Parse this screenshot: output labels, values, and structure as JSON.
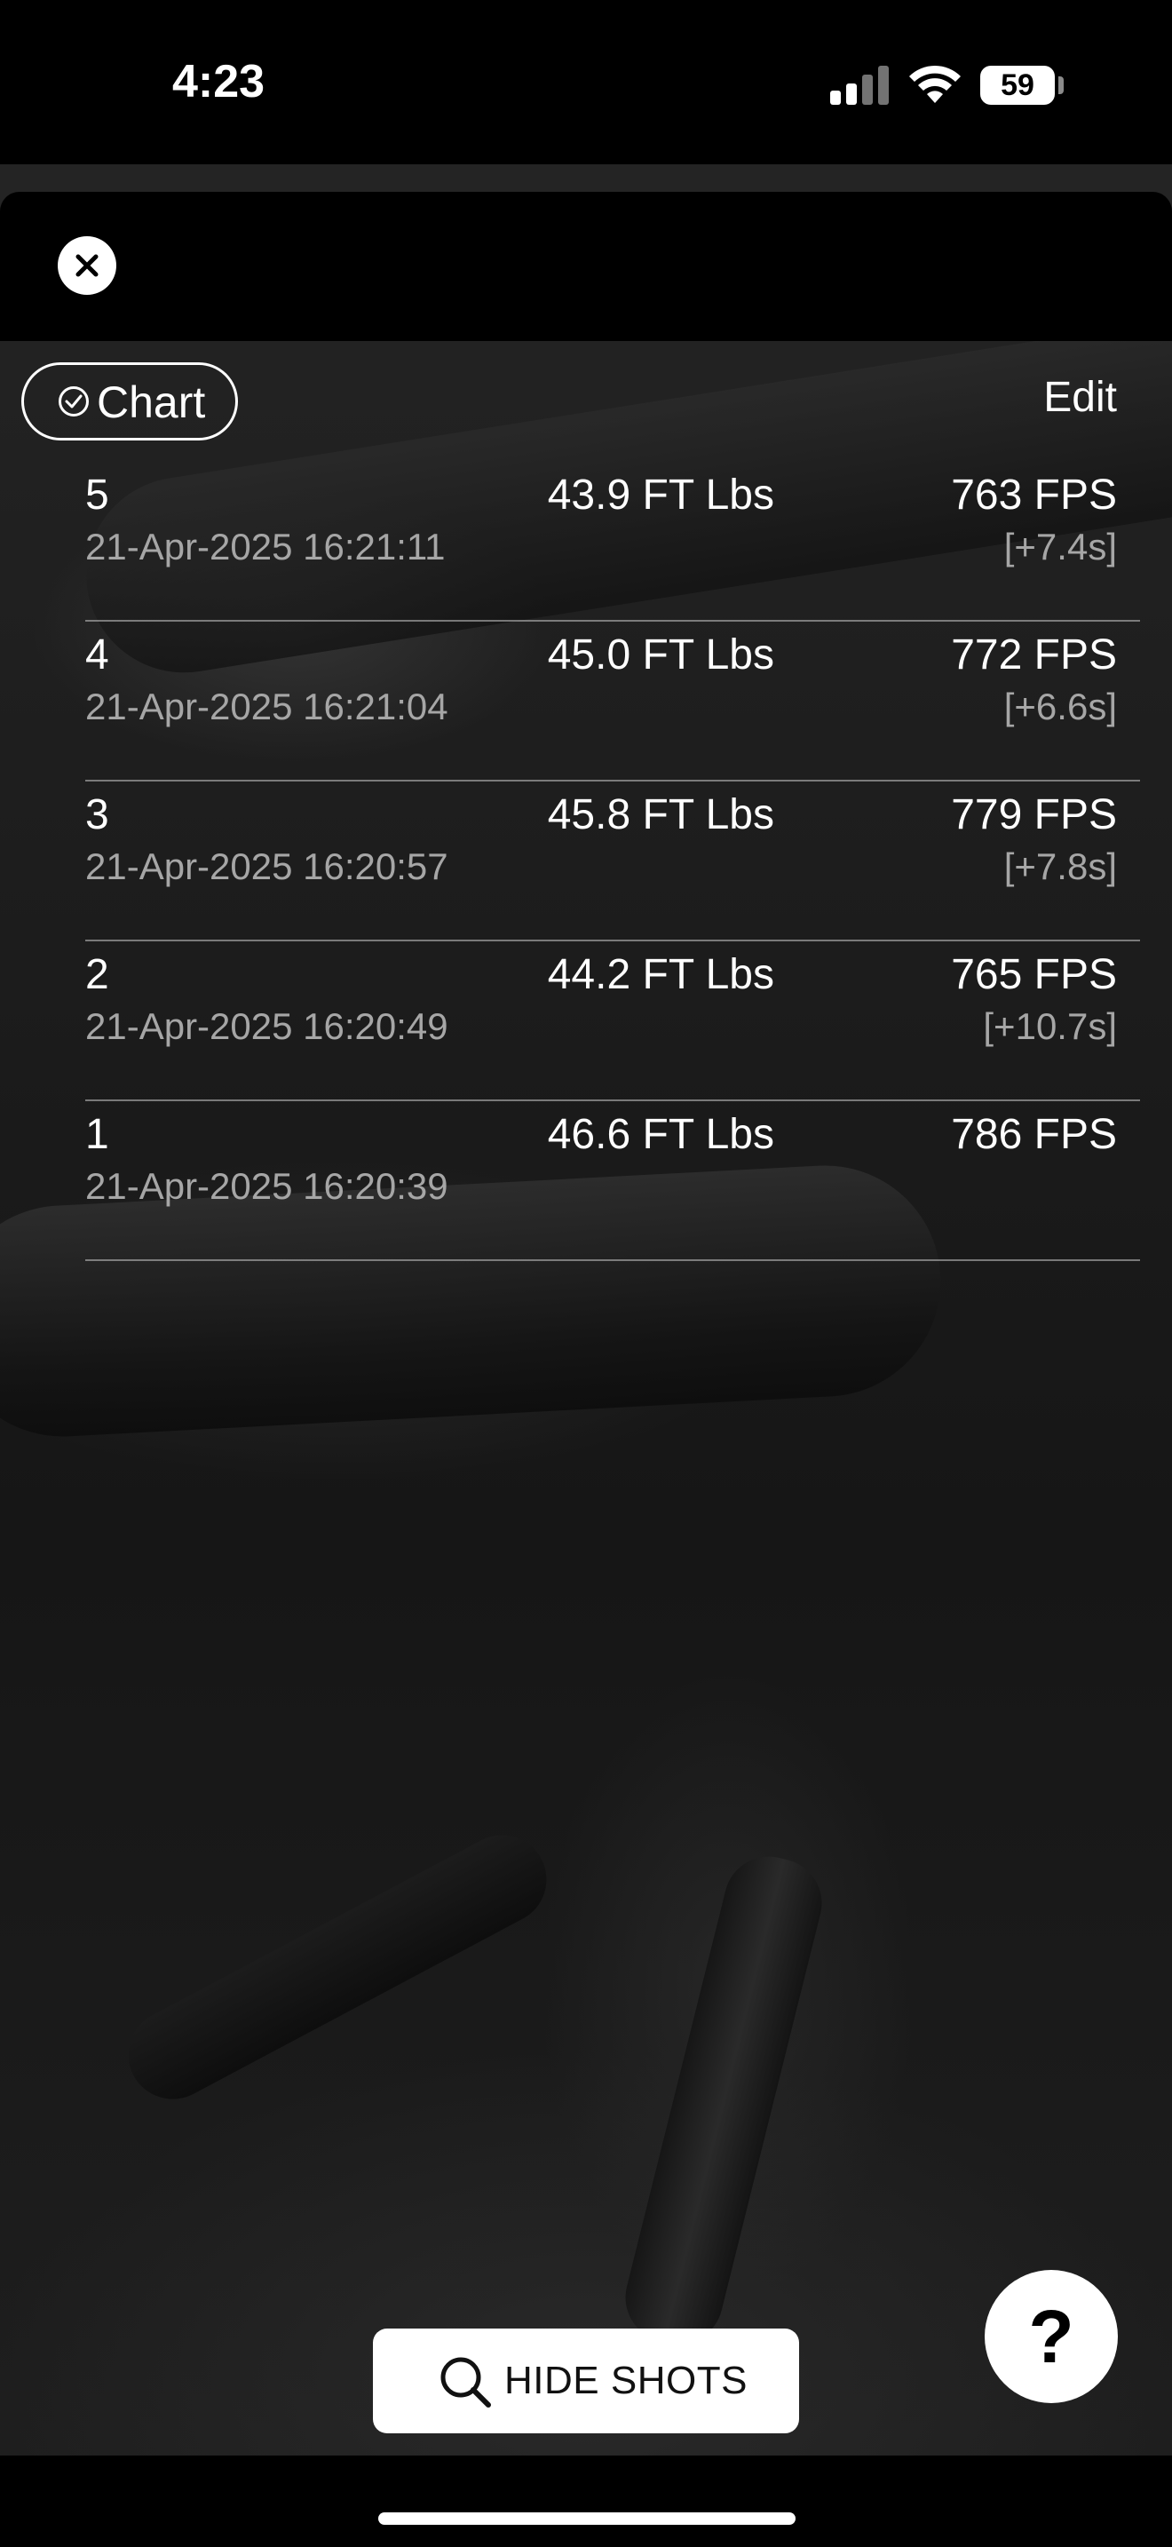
{
  "status_bar": {
    "time": "4:23",
    "battery": "59",
    "icons": [
      "cellular-signal-icon",
      "wifi-icon",
      "battery-icon"
    ]
  },
  "header": {
    "close_icon": "close-icon"
  },
  "toolbar": {
    "chart_label": "Chart",
    "chart_icon": "check-circle-icon",
    "edit_label": "Edit"
  },
  "shots": [
    {
      "number": "5",
      "energy": "43.9 FT Lbs",
      "velocity": "763 FPS",
      "timestamp": "21-Apr-2025 16:21:11",
      "delta": "[+7.4s]"
    },
    {
      "number": "4",
      "energy": "45.0 FT Lbs",
      "velocity": "772 FPS",
      "timestamp": "21-Apr-2025 16:21:04",
      "delta": "[+6.6s]"
    },
    {
      "number": "3",
      "energy": "45.8 FT Lbs",
      "velocity": "779 FPS",
      "timestamp": "21-Apr-2025 16:20:57",
      "delta": "[+7.8s]"
    },
    {
      "number": "2",
      "energy": "44.2 FT Lbs",
      "velocity": "765 FPS",
      "timestamp": "21-Apr-2025 16:20:49",
      "delta": "[+10.7s]"
    },
    {
      "number": "1",
      "energy": "46.6 FT Lbs",
      "velocity": "786 FPS",
      "timestamp": "21-Apr-2025 16:20:39",
      "delta": ""
    }
  ],
  "footer": {
    "hide_shots_label": "HIDE SHOTS",
    "hide_shots_icon": "search-icon",
    "help_label": "?"
  },
  "colors": {
    "background": "#000000",
    "text_primary": "#ffffff",
    "text_secondary": "#a6a6a6",
    "divider": "#c8c8c8"
  }
}
